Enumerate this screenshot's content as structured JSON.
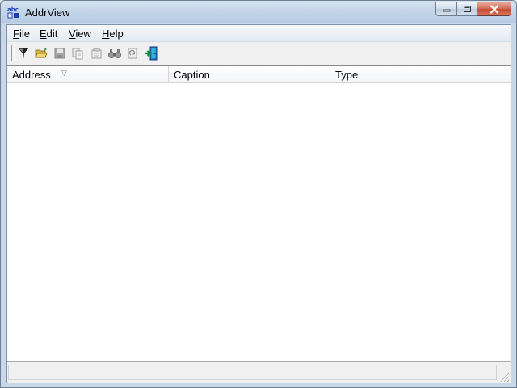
{
  "window": {
    "title": "AddrView"
  },
  "menubar": {
    "items": [
      {
        "label": "File",
        "accel": "F",
        "rest": "ile"
      },
      {
        "label": "Edit",
        "accel": "E",
        "rest": "dit"
      },
      {
        "label": "View",
        "accel": "V",
        "rest": "iew"
      },
      {
        "label": "Help",
        "accel": "H",
        "rest": "elp"
      }
    ]
  },
  "toolbar": {
    "buttons": [
      {
        "icon": "filter-icon",
        "enabled": true
      },
      {
        "icon": "open-folder-icon",
        "enabled": true
      },
      {
        "icon": "save-icon",
        "enabled": false
      },
      {
        "icon": "copy-icon",
        "enabled": false
      },
      {
        "icon": "properties-icon",
        "enabled": false
      },
      {
        "icon": "find-icon",
        "enabled": false
      },
      {
        "icon": "refresh-icon",
        "enabled": false
      },
      {
        "icon": "exit-icon",
        "enabled": true
      }
    ]
  },
  "listview": {
    "columns": [
      {
        "label": "Address",
        "sorted": true
      },
      {
        "label": "Caption",
        "sorted": false
      },
      {
        "label": "Type",
        "sorted": false
      },
      {
        "label": "",
        "sorted": false
      }
    ],
    "rows": []
  },
  "statusbar": {
    "text": ""
  },
  "colors": {
    "titlebar": "#c2d4e8",
    "close_button": "#c24a30",
    "accent": "#2a6fc9"
  }
}
